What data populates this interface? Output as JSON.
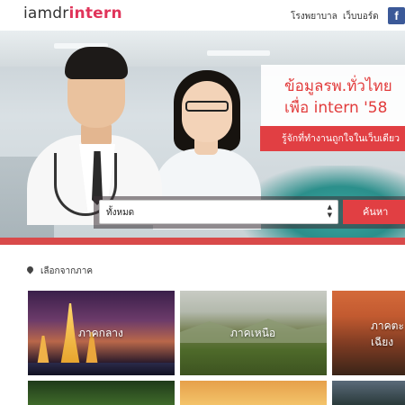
{
  "header": {
    "logo_part1": "iamdr",
    "logo_part2": "intern",
    "nav": [
      "โรงพยาบาล",
      "เว็บบอร์ด"
    ],
    "facebook_glyph": "f"
  },
  "hero": {
    "headline_line1": "ข้อมูลรพ.ทั่วไทย",
    "headline_line2": "เพื่อ intern '58",
    "cta_label": "รู้จักที่ทำงานถูกใจในเว็บเดียว"
  },
  "search": {
    "select_value": "ทั้งหมด",
    "button_label": "ค้นหา"
  },
  "regions": {
    "heading": "เลือกจากภาค",
    "cards": [
      {
        "label": "ภาคกลาง"
      },
      {
        "label": "ภาคเหนือ"
      },
      {
        "label": "ภาคตะวันออกเฉียงเหนือ",
        "visible_label": "ภาคตะ เฉียง"
      }
    ]
  },
  "colors": {
    "brand_red": "#e13f43",
    "logo_pink": "#e0345a",
    "facebook_blue": "#3b5998"
  },
  "icons": [
    "facebook-icon",
    "map-pin-icon",
    "select-arrows-icon"
  ]
}
